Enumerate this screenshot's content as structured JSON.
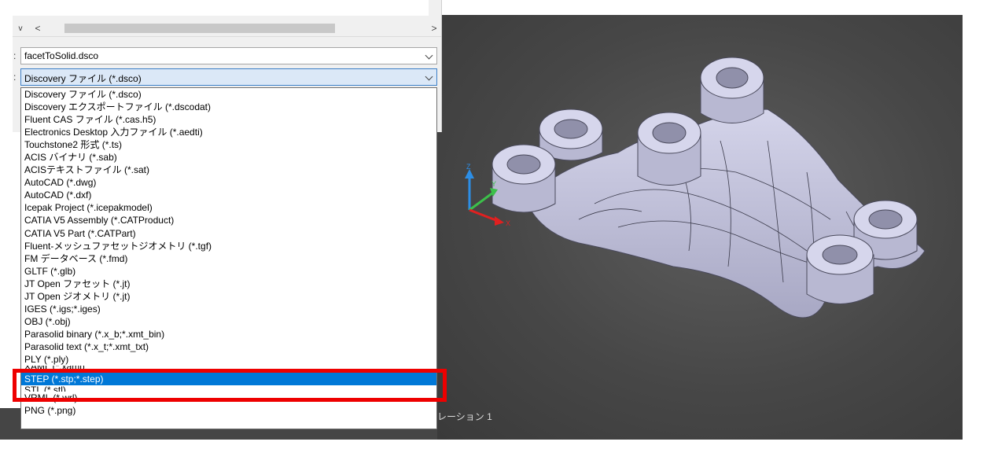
{
  "dialog": {
    "file_name": "facetToSolid.dsco",
    "file_type": "Discovery ファイル (*.dsco)",
    "file_name_label": ":",
    "file_type_label": ":",
    "scroll_left": "<",
    "scroll_right": ">",
    "scroll_down": "v"
  },
  "file_types": {
    "items": [
      "Discovery ファイル (*.dsco)",
      "Discovery エクスポートファイル (*.dscodat)",
      "Fluent CAS ファイル (*.cas.h5)",
      "Electronics Desktop 入力ファイル (*.aedti)",
      "Touchstone2 形式 (*.ts)",
      "ACIS バイナリ (*.sab)",
      "ACISテキストファイル (*.sat)",
      "AutoCAD (*.dwg)",
      "AutoCAD (*.dxf)",
      "Icepak Project (*.icepakmodel)",
      "CATIA V5 Assembly (*.CATProduct)",
      "CATIA V5 Part (*.CATPart)",
      "Fluent-メッシュファセットジオメトリ (*.tgf)",
      "FM データベース (*.fmd)",
      "GLTF (*.glb)",
      "JT Open ファセット (*.jt)",
      "JT Open ジオメトリ (*.jt)",
      "IGES (*.igs;*.iges)",
      "OBJ (*.obj)",
      "Parasolid binary (*.x_b;*.xmt_bin)",
      "Parasolid text (*.x_t;*.xmt_txt)",
      "PLY (*.ply)"
    ],
    "clipped_above": "XAML (*.xaml)",
    "selected": "STEP (*.stp;*.step)",
    "clipped_below": "STL (*.stl)",
    "after": [
      "VRML (*.wrl)",
      "PNG (*.png)"
    ]
  },
  "viewport": {
    "label": "レーション 1",
    "triad": {
      "z": "Z",
      "y": "Y",
      "x": "X"
    },
    "part_color": "#c8c8e0",
    "background_color": "#4a4a4a"
  },
  "annotation": {
    "highlight_color": "#ee0000"
  }
}
